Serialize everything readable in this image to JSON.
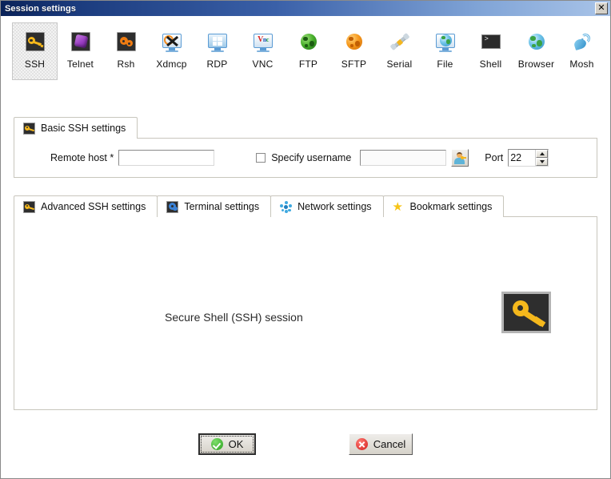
{
  "window": {
    "title": "Session settings",
    "close_label": "✕"
  },
  "protocols": [
    {
      "label": "SSH",
      "icon": "ssh-key-icon",
      "selected": true
    },
    {
      "label": "Telnet",
      "icon": "telnet-cube-icon",
      "selected": false
    },
    {
      "label": "Rsh",
      "icon": "rsh-gears-icon",
      "selected": false
    },
    {
      "label": "Xdmcp",
      "icon": "xdmcp-monitor-icon",
      "selected": false
    },
    {
      "label": "RDP",
      "icon": "rdp-windows-icon",
      "selected": false
    },
    {
      "label": "VNC",
      "icon": "vnc-monitor-icon",
      "selected": false
    },
    {
      "label": "FTP",
      "icon": "ftp-green-globe-icon",
      "selected": false
    },
    {
      "label": "SFTP",
      "icon": "sftp-orange-globe-icon",
      "selected": false
    },
    {
      "label": "Serial",
      "icon": "serial-connector-icon",
      "selected": false
    },
    {
      "label": "File",
      "icon": "file-monitor-globe-icon",
      "selected": false
    },
    {
      "label": "Shell",
      "icon": "shell-terminal-icon",
      "selected": false
    },
    {
      "label": "Browser",
      "icon": "browser-globe-icon",
      "selected": false
    },
    {
      "label": "Mosh",
      "icon": "mosh-satellite-icon",
      "selected": false
    }
  ],
  "basic_tab": {
    "label": "Basic SSH settings",
    "icon": "key-icon"
  },
  "basic_form": {
    "remote_host_label": "Remote host *",
    "remote_host_value": "",
    "remote_host_placeholder": "",
    "specify_username_label": "Specify username",
    "specify_username_checked": false,
    "username_value": "",
    "username_placeholder": "",
    "user_button_icon": "user-key-icon",
    "port_label": "Port",
    "port_value": "22",
    "spinner_up_icon": "spinner-up-icon",
    "spinner_down_icon": "spinner-down-icon"
  },
  "settings_tabs": [
    {
      "label": "Advanced SSH settings",
      "icon": "key-icon",
      "active": false
    },
    {
      "label": "Terminal settings",
      "icon": "gear-icon",
      "active": false
    },
    {
      "label": "Network settings",
      "icon": "network-icon",
      "active": false
    },
    {
      "label": "Bookmark settings",
      "icon": "star-icon",
      "active": false
    }
  ],
  "main_panel": {
    "description": "Secure Shell (SSH) session",
    "illustration_icon": "large-key-icon"
  },
  "footer": {
    "ok_label": "OK",
    "ok_icon": "green-check-icon",
    "cancel_label": "Cancel",
    "cancel_icon": "red-cross-icon"
  },
  "colors": {
    "title_gradient_start": "#0a2259",
    "title_gradient_end": "#a9c4e8",
    "key_gold": "#f5b81c",
    "icon_dark_bg": "#2e2e2e",
    "panel_border": "#c8c6bd",
    "ok_green": "#2aa11e",
    "cancel_red": "#d21d1d"
  }
}
